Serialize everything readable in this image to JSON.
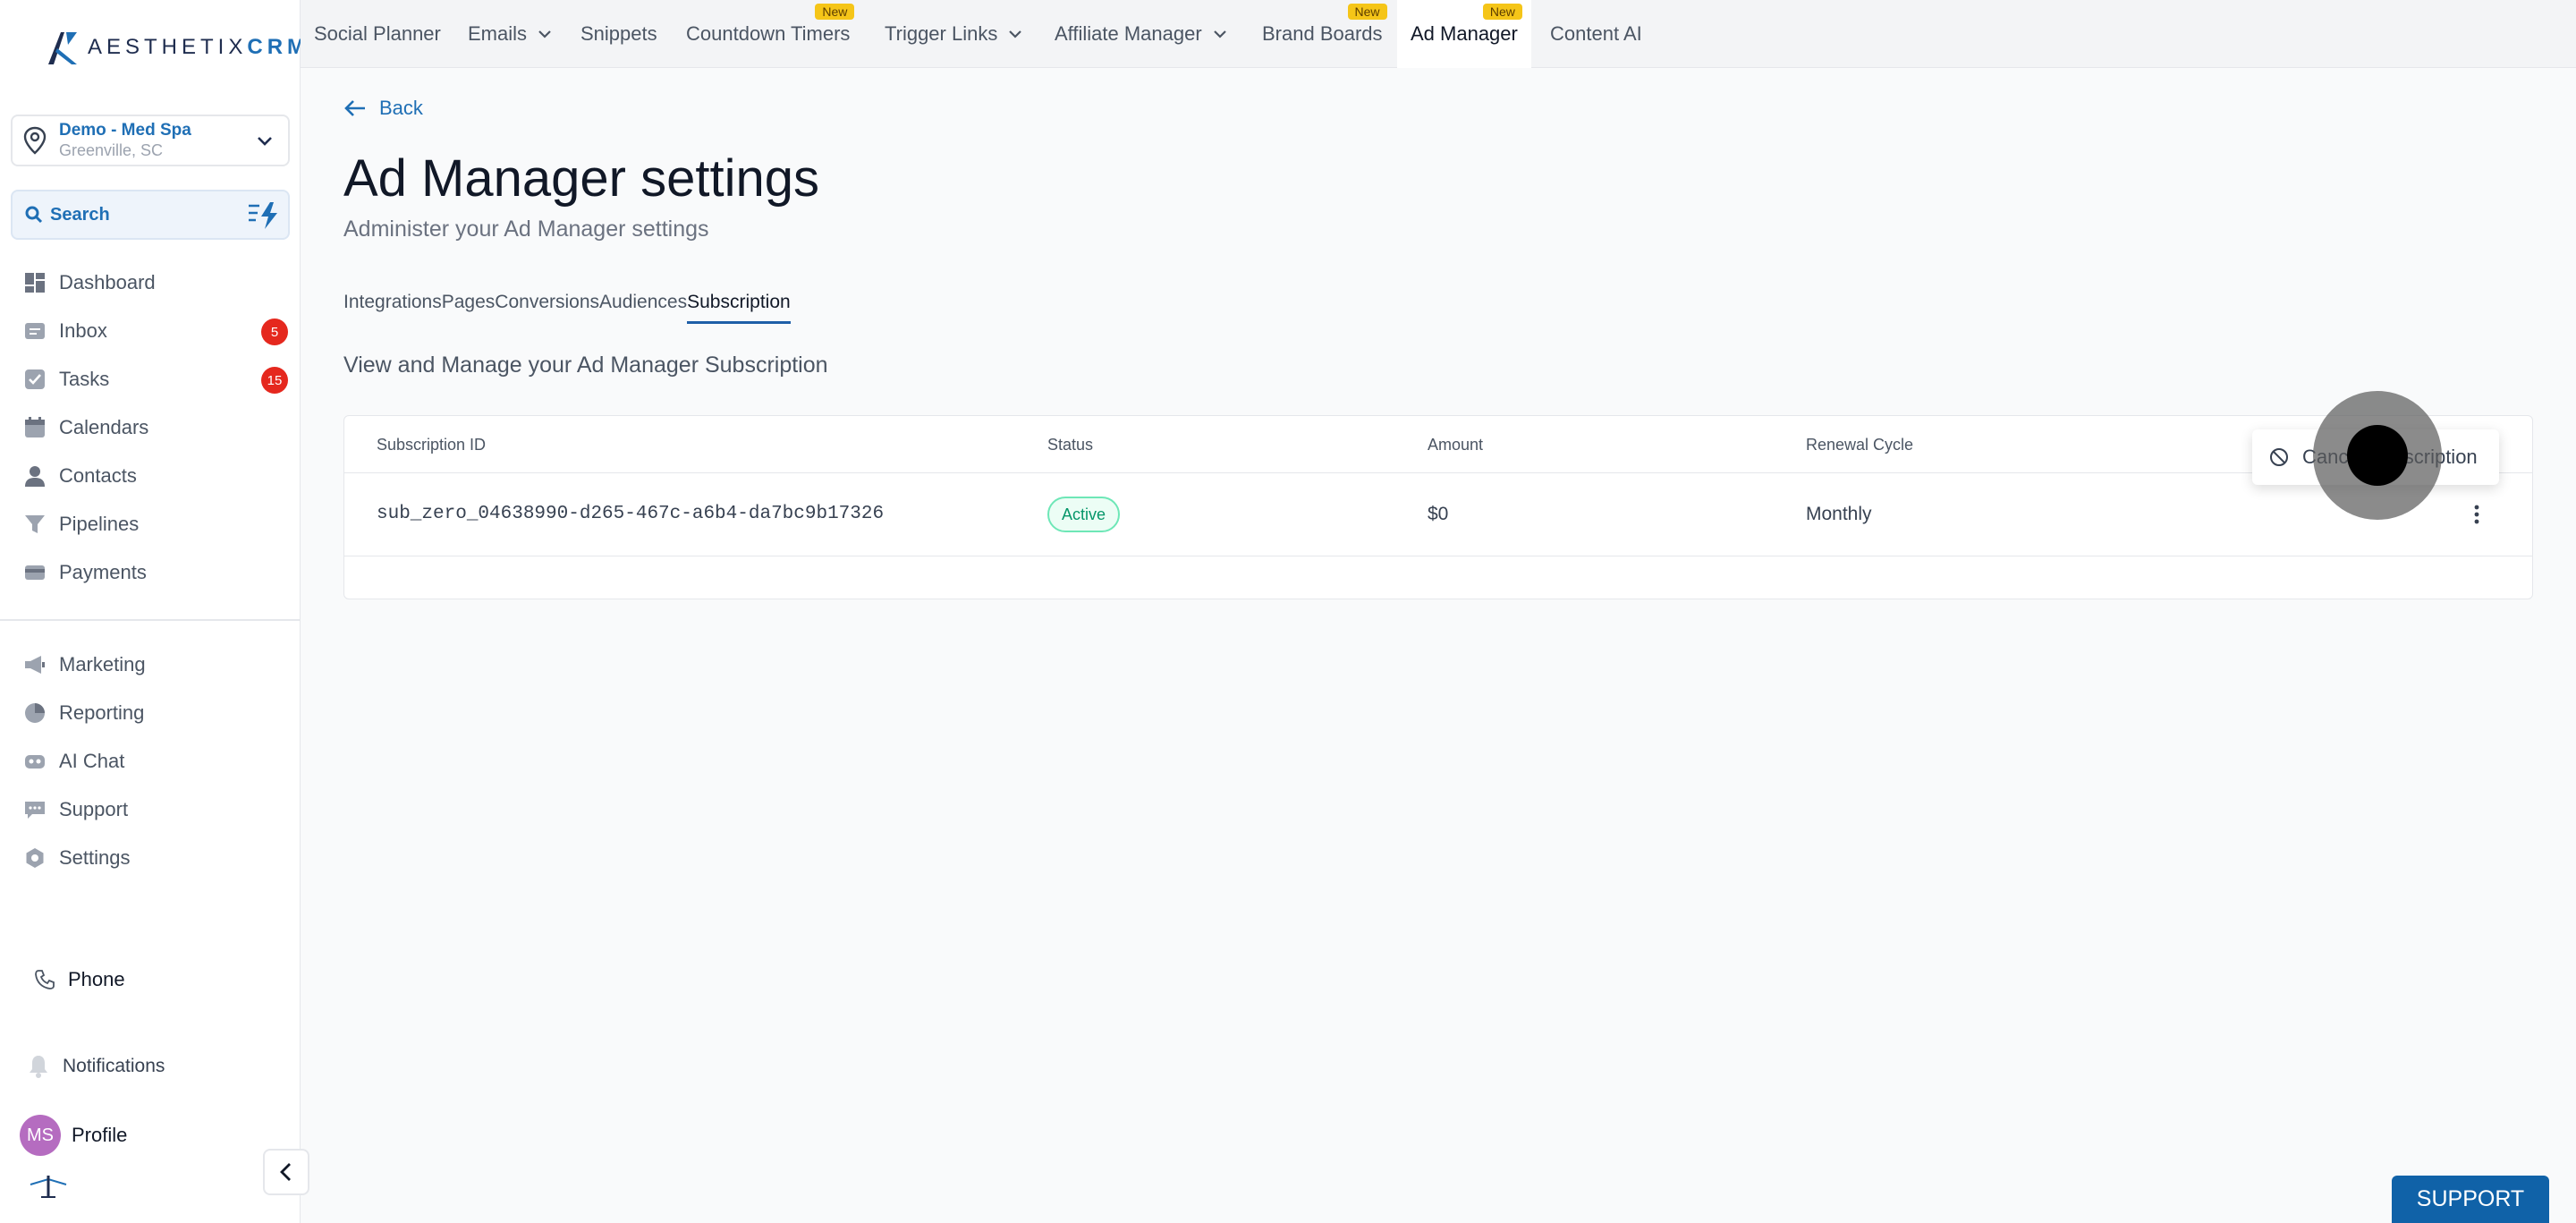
{
  "brand": {
    "name_light": "AESTHETIX",
    "name_bold": "CRM"
  },
  "location": {
    "name": "Demo - Med Spa",
    "city": "Greenville, SC"
  },
  "search": {
    "label": "Search"
  },
  "sidebar": {
    "items": [
      {
        "label": "Dashboard",
        "icon": "dashboard-icon"
      },
      {
        "label": "Inbox",
        "icon": "inbox-icon",
        "badge": "5"
      },
      {
        "label": "Tasks",
        "icon": "tasks-icon",
        "badge": "15"
      },
      {
        "label": "Calendars",
        "icon": "calendar-icon"
      },
      {
        "label": "Contacts",
        "icon": "contacts-icon"
      },
      {
        "label": "Pipelines",
        "icon": "pipeline-icon"
      },
      {
        "label": "Payments",
        "icon": "payments-icon"
      }
    ],
    "items2": [
      {
        "label": "Marketing",
        "icon": "megaphone-icon"
      },
      {
        "label": "Reporting",
        "icon": "pie-chart-icon"
      },
      {
        "label": "AI Chat",
        "icon": "robot-icon"
      },
      {
        "label": "Support",
        "icon": "chat-icon"
      },
      {
        "label": "Settings",
        "icon": "gear-icon"
      }
    ],
    "phone": "Phone",
    "notifications": "Notifications",
    "profile": "Profile",
    "avatar_initials": "MS"
  },
  "topnav": {
    "tabs": [
      {
        "label": "Social Planner"
      },
      {
        "label": "Emails",
        "dropdown": true
      },
      {
        "label": "Snippets"
      },
      {
        "label": "Countdown Timers",
        "new": "New"
      },
      {
        "label": "Trigger Links",
        "dropdown": true
      },
      {
        "label": "Affiliate Manager",
        "dropdown": true
      },
      {
        "label": "Brand Boards",
        "new": "New"
      },
      {
        "label": "Ad Manager",
        "new": "New",
        "active": true
      },
      {
        "label": "Content AI"
      }
    ]
  },
  "page": {
    "back": "Back",
    "title": "Ad Manager settings",
    "subtitle": "Administer your Ad Manager settings",
    "subtabs": [
      "Integrations",
      "Pages",
      "Conversions",
      "Audiences",
      "Subscription"
    ],
    "active_subtab": "Subscription",
    "section_title": "View and Manage your Ad Manager Subscription"
  },
  "table": {
    "headers": [
      "Subscription ID",
      "Status",
      "Amount",
      "Renewal Cycle"
    ],
    "row": {
      "subscription_id": "sub_zero_04638990-d265-467c-a6b4-da7bc9b17326",
      "status": "Active",
      "amount": "$0",
      "renewal_cycle": "Monthly"
    }
  },
  "menu": {
    "cancel_label": "Cancel Subscription"
  },
  "support_button": "SUPPORT",
  "colors": {
    "accent": "#1f6fb5",
    "badge": "#e5281e",
    "new_badge": "#f5c518",
    "active_green": "#059669"
  }
}
